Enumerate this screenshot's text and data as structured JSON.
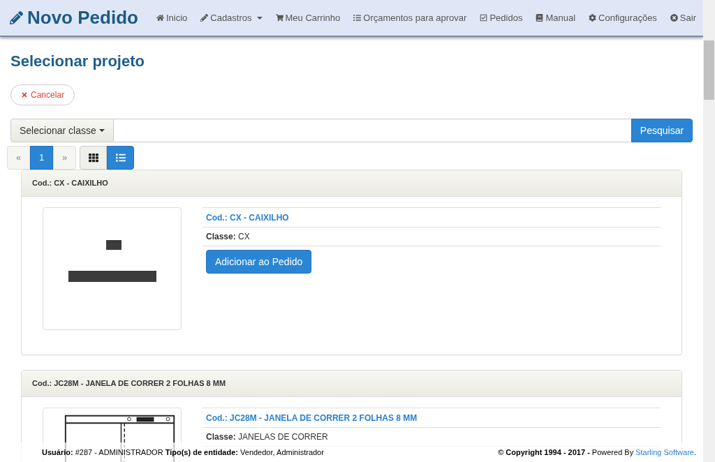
{
  "brand": {
    "title": "Novo Pedido"
  },
  "nav": [
    {
      "label": "Inicio",
      "dropdown": false
    },
    {
      "label": "Cadastros",
      "dropdown": true
    },
    {
      "label": "Meu Carrinho",
      "dropdown": false
    },
    {
      "label": "Orçamentos para aprovar",
      "dropdown": false
    },
    {
      "label": "Pedidos",
      "dropdown": false
    },
    {
      "label": "Manual",
      "dropdown": false
    },
    {
      "label": "Configurações",
      "dropdown": false
    },
    {
      "label": "Sair",
      "dropdown": false
    }
  ],
  "page_title": "Selecionar projeto",
  "cancel_button": "Cancelar",
  "search": {
    "class_dropdown": "Selecionar classe",
    "button": "Pesquisar"
  },
  "pagination": [
    {
      "label": "«",
      "selected": false
    },
    {
      "label": "1",
      "selected": true
    },
    {
      "label": "»",
      "selected": false
    }
  ],
  "view_modes": [
    {
      "kind": "grid",
      "selected": false
    },
    {
      "kind": "list",
      "selected": true
    }
  ],
  "projects": [
    {
      "header": "Cod.: CX - CAIXILHO",
      "link": "Cod.: CX - CAIXILHO",
      "class_label": "Classe:",
      "class_value": "CX",
      "button": "Adicionar ao Pedido"
    },
    {
      "header": "Cod.: JC28M - JANELA DE CORRER 2 FOLHAS 8 MM",
      "link": "Cod.: JC28M - JANELA DE CORRER 2 FOLHAS 8 MM",
      "class_label": "Classe:",
      "class_value": "JANELAS DE CORRER"
    }
  ],
  "footer": {
    "user": "**Usuário:** #287 - ADMINISTRADOR **Tipo(s) de entidade:** Vendedor, Administrador",
    "copyright": "**© Copyright 1994 - 2017 -** Powered By",
    "link": "Starling Software",
    "end": "."
  }
}
